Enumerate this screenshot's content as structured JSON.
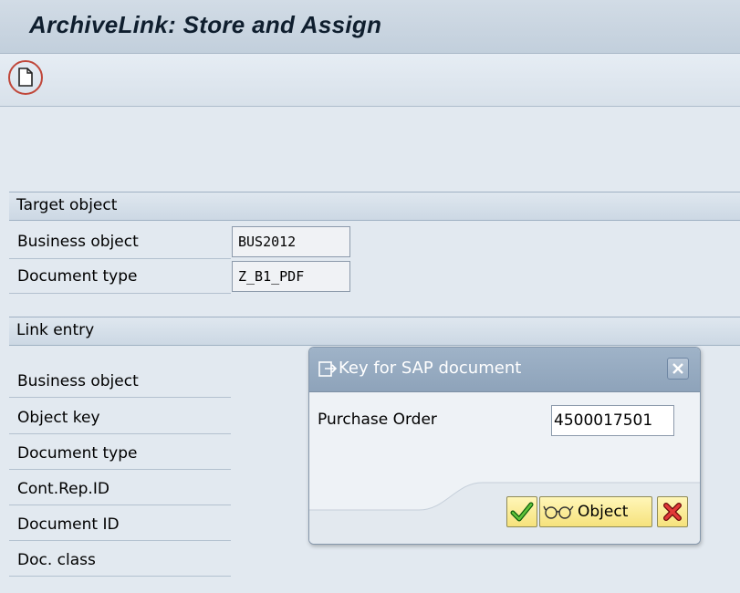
{
  "window": {
    "title": "ArchiveLink: Store and Assign"
  },
  "toolbar": {
    "new_document_icon": "new-document-icon"
  },
  "target_object": {
    "header": "Target object",
    "fields": [
      {
        "label": "Business object",
        "value": "BUS2012"
      },
      {
        "label": "Document type",
        "value": "Z_B1_PDF"
      }
    ]
  },
  "link_entry": {
    "header": "Link entry",
    "fields": [
      {
        "label": "Business object"
      },
      {
        "label": "Object key"
      },
      {
        "label": "Document type"
      },
      {
        "label": "Cont.Rep.ID"
      },
      {
        "label": "Document ID"
      },
      {
        "label": "Doc. class"
      }
    ]
  },
  "dialog": {
    "title": "Key for SAP document",
    "field_label": "Purchase Order",
    "field_value": "4500017501",
    "buttons": {
      "ok_icon": "checkmark-icon",
      "object_label": "Object",
      "object_icon": "glasses-icon",
      "cancel_icon": "cancel-x-icon"
    }
  },
  "colors": {
    "highlight_circle": "#c0473a",
    "dialog_title_bg": "#9fb3c8",
    "button_bg": "#f6e27c"
  }
}
